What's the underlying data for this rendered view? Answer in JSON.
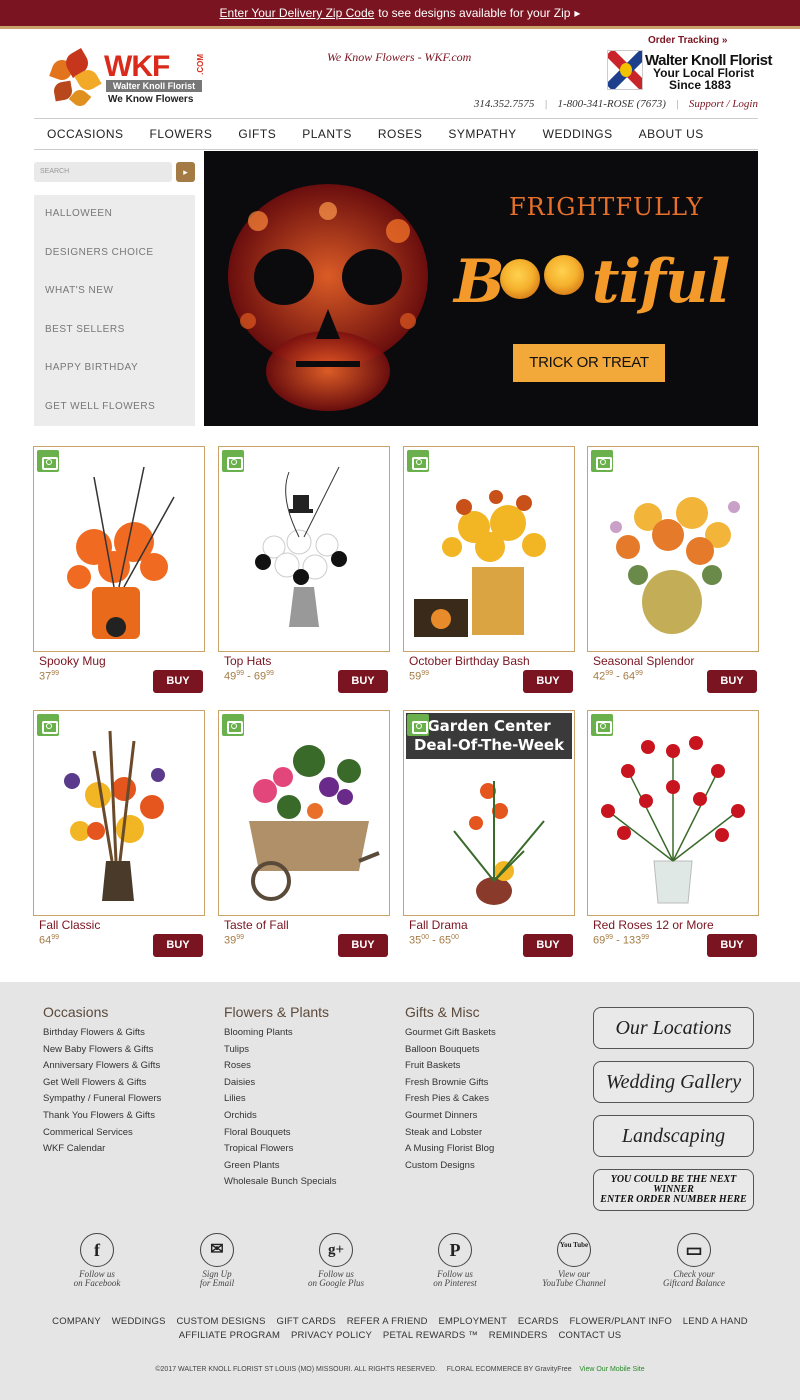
{
  "topbar": {
    "link": "Enter Your Delivery Zip Code",
    "text": "to see designs available for your Zip",
    "arrow": "▸"
  },
  "header": {
    "logo_main": "WKF",
    "logo_com": ".COM",
    "logo_sub": "Walter Knoll Florist",
    "logo_tag": "We Know Flowers",
    "tagline": "We Know Flowers - WKF.com",
    "order_tracking": "Order Tracking »",
    "brand_line1": "Walter Knoll Florist",
    "brand_line2": "Your Local Florist",
    "brand_line3": "Since 1883",
    "phone1": "314.352.7575",
    "phone2": "1-800-341-ROSE (7673)",
    "support": "Support / Login"
  },
  "nav": [
    "OCCASIONS",
    "FLOWERS",
    "GIFTS",
    "PLANTS",
    "ROSES",
    "SYMPATHY",
    "WEDDINGS",
    "ABOUT US"
  ],
  "search": {
    "placeholder": "SEARCH",
    "button": "▸"
  },
  "sidebar": [
    "HALLOWEEN",
    "DESIGNERS CHOICE",
    "WHAT'S NEW",
    "BEST SELLERS",
    "HAPPY BIRTHDAY",
    "GET WELL FLOWERS"
  ],
  "hero": {
    "line1": "FRIGHTFULLY",
    "line2_pre": "B",
    "line2_post": "tiful",
    "cta": "TRICK OR TREAT"
  },
  "products": [
    {
      "name": "Spooky Mug",
      "price": "37",
      "cents": "99",
      "buy": "BUY"
    },
    {
      "name": "Top Hats",
      "price": "49",
      "cents": "99",
      "price2": "69",
      "cents2": "99",
      "buy": "BUY"
    },
    {
      "name": "October Birthday Bash",
      "price": "59",
      "cents": "99",
      "buy": "BUY"
    },
    {
      "name": "Seasonal Splendor",
      "price": "42",
      "cents": "99",
      "price2": "64",
      "cents2": "99",
      "buy": "BUY"
    },
    {
      "name": "Fall Classic",
      "price": "64",
      "cents": "99",
      "buy": "BUY"
    },
    {
      "name": "Taste of Fall",
      "price": "39",
      "cents": "99",
      "buy": "BUY"
    },
    {
      "name": "Fall Drama",
      "price": "35",
      "cents": "00",
      "price2": "65",
      "cents2": "00",
      "buy": "BUY",
      "banner1": "Garden Center",
      "banner2": "Deal-Of-The-Week"
    },
    {
      "name": "Red Roses 12 or More",
      "price": "69",
      "cents": "99",
      "price2": "133",
      "cents2": "99",
      "buy": "BUY"
    }
  ],
  "footer": {
    "occasions": {
      "title": "Occasions",
      "items": [
        "Birthday Flowers & Gifts",
        "New Baby Flowers & Gifts",
        "Anniversary Flowers & Gifts",
        "Get Well Flowers & Gifts",
        "Sympathy / Funeral Flowers",
        "Thank You Flowers & Gifts",
        "Commerical Services",
        "WKF Calendar"
      ]
    },
    "flowers": {
      "title": "Flowers & Plants",
      "items": [
        "Blooming Plants",
        "Tulips",
        "Roses",
        "Daisies",
        "Lilies",
        "Orchids",
        "Floral Bouquets",
        "Tropical Flowers",
        "Green Plants",
        "Wholesale Bunch Specials"
      ]
    },
    "gifts": {
      "title": "Gifts & Misc",
      "items": [
        "Gourmet Gift Baskets",
        "Balloon Bouquets",
        "Fruit Baskets",
        "Fresh Brownie Gifts",
        "Fresh Pies & Cakes",
        "Gourmet Dinners",
        "Steak and Lobster",
        "A Musing Florist Blog",
        "Custom Designs"
      ]
    },
    "buttons": [
      "Our Locations",
      "Wedding Gallery",
      "Landscaping"
    ],
    "winner1": "YOU COULD BE THE NEXT WINNER",
    "winner2": "ENTER ORDER NUMBER HERE",
    "social": [
      {
        "icon": "f",
        "l1": "Follow us",
        "l2": "on Facebook"
      },
      {
        "icon": "✉",
        "l1": "Sign Up",
        "l2": "for Email"
      },
      {
        "icon": "g+",
        "l1": "Follow us",
        "l2": "on Google Plus"
      },
      {
        "icon": "P",
        "l1": "Follow us",
        "l2": "on Pinterest"
      },
      {
        "icon": "You Tube",
        "l1": "View our",
        "l2": "YouTube Channel"
      },
      {
        "icon": "▭",
        "l1": "Check your",
        "l2": "Giftcard Balance"
      }
    ],
    "links1": [
      "COMPANY",
      "WEDDINGS",
      "CUSTOM DESIGNS",
      "GIFT CARDS",
      "REFER A FRIEND",
      "EMPLOYMENT",
      "ECARDS",
      "FLOWER/PLANT INFO",
      "LEND A HAND"
    ],
    "links2": [
      "AFFILIATE PROGRAM",
      "PRIVACY POLICY",
      "PETAL REWARDS ™",
      "REMINDERS",
      "CONTACT US"
    ],
    "copyright": "©2017 WALTER KNOLL FLORIST ST LOUIS (MO) MISSOURI. ALL RIGHTS RESERVED.",
    "ecom": "FLORAL ECOMMERCE BY",
    "ecom_brand": "GravityFree",
    "mobile": "View Our Mobile Site"
  }
}
